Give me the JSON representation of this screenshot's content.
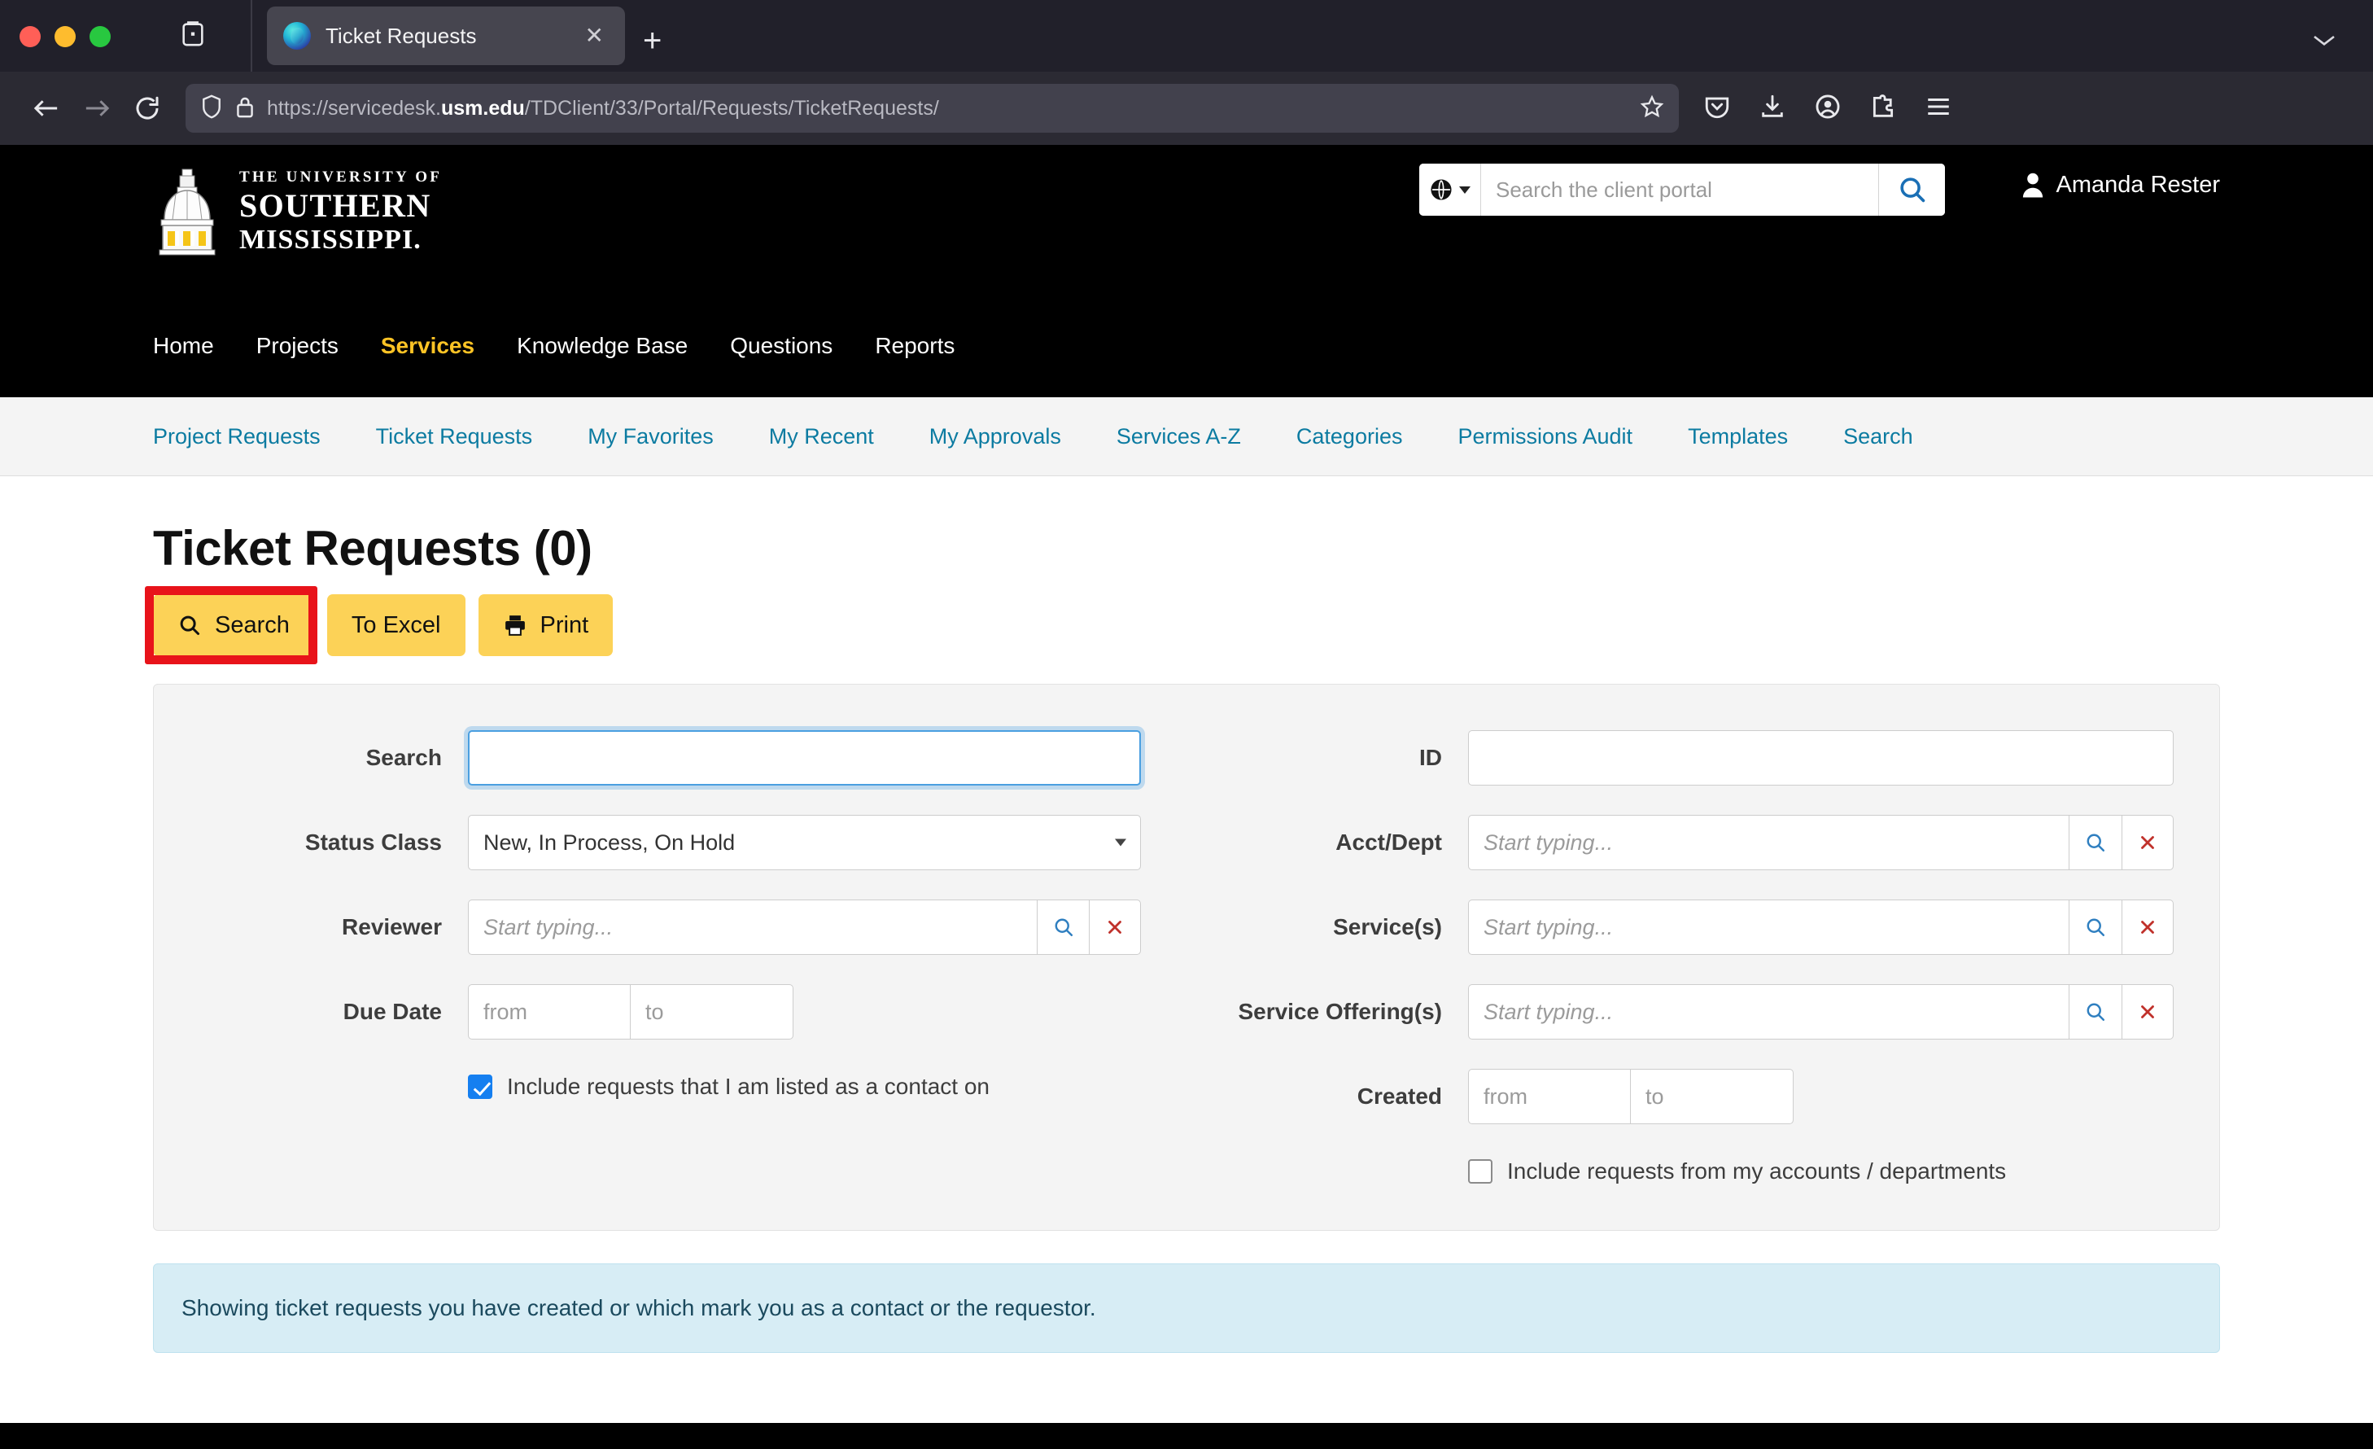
{
  "browser": {
    "tab": {
      "title": "Ticket Requests",
      "favicon": "teamdynamix-icon",
      "close": "✕"
    },
    "new_tab": "+",
    "url": {
      "scheme": "https://servicedesk.",
      "domain": "usm.edu",
      "path": "/TDClient/33/Portal/Requests/TicketRequests/"
    },
    "toolbar_icons": [
      "pocket-icon",
      "download-icon",
      "account-icon",
      "extensions-icon",
      "menu-icon"
    ]
  },
  "site": {
    "logo": {
      "line1": "THE UNIVERSITY OF",
      "line2": "SOUTHERN",
      "line3": "MISSISSIPPI."
    },
    "portal_search": {
      "placeholder": "Search the client portal",
      "value": "",
      "scope_icon": "globe-icon",
      "go_icon": "search-icon"
    },
    "user": {
      "name": "Amanda Rester",
      "icon": "person-icon"
    },
    "main_nav": [
      {
        "label": "Home",
        "active": false
      },
      {
        "label": "Projects",
        "active": false
      },
      {
        "label": "Services",
        "active": true
      },
      {
        "label": "Knowledge Base",
        "active": false
      },
      {
        "label": "Questions",
        "active": false
      },
      {
        "label": "Reports",
        "active": false
      }
    ],
    "sub_nav": [
      "Project Requests",
      "Ticket Requests",
      "My Favorites",
      "My Recent",
      "My Approvals",
      "Services A-Z",
      "Categories",
      "Permissions Audit",
      "Templates",
      "Search"
    ]
  },
  "main": {
    "title": "Ticket Requests (0)",
    "buttons": [
      {
        "label": "Search",
        "icon": "search-icon",
        "highlighted": true
      },
      {
        "label": "To Excel",
        "icon": "",
        "highlighted": false
      },
      {
        "label": "Print",
        "icon": "printer-icon",
        "highlighted": false
      }
    ],
    "filters": {
      "left": {
        "search": {
          "label": "Search",
          "value": "",
          "placeholder": "",
          "focused": true
        },
        "status_class": {
          "label": "Status Class",
          "value": "New, In Process, On Hold"
        },
        "reviewer": {
          "label": "Reviewer",
          "value": "",
          "placeholder": "Start typing...",
          "lookup_icon": "search-icon",
          "clear_icon": "x-icon"
        },
        "due_date": {
          "label": "Due Date",
          "from_placeholder": "from",
          "to_placeholder": "to",
          "from_value": "",
          "to_value": ""
        },
        "contact_checkbox": {
          "label": "Include requests that I am listed as a contact on",
          "checked": true
        }
      },
      "right": {
        "id": {
          "label": "ID",
          "value": "",
          "placeholder": ""
        },
        "acct_dept": {
          "label": "Acct/Dept",
          "value": "",
          "placeholder": "Start typing...",
          "lookup_icon": "search-icon",
          "clear_icon": "x-icon"
        },
        "services": {
          "label": "Service(s)",
          "value": "",
          "placeholder": "Start typing...",
          "lookup_icon": "search-icon",
          "clear_icon": "x-icon"
        },
        "service_offerings": {
          "label": "Service Offering(s)",
          "value": "",
          "placeholder": "Start typing...",
          "lookup_icon": "search-icon",
          "clear_icon": "x-icon"
        },
        "created": {
          "label": "Created",
          "from_placeholder": "from",
          "to_placeholder": "to",
          "from_value": "",
          "to_value": ""
        },
        "accounts_checkbox": {
          "label": "Include requests from my accounts / departments",
          "checked": false
        }
      }
    },
    "info_alert": "Showing ticket requests you have created or which mark you as a contact or the requestor."
  },
  "colors": {
    "brand_gold": "#fcd257",
    "link_teal": "#0c7ba1",
    "active_nav": "#ffc425",
    "highlight_red": "#e8131a",
    "info_bg": "#d7edf5"
  }
}
